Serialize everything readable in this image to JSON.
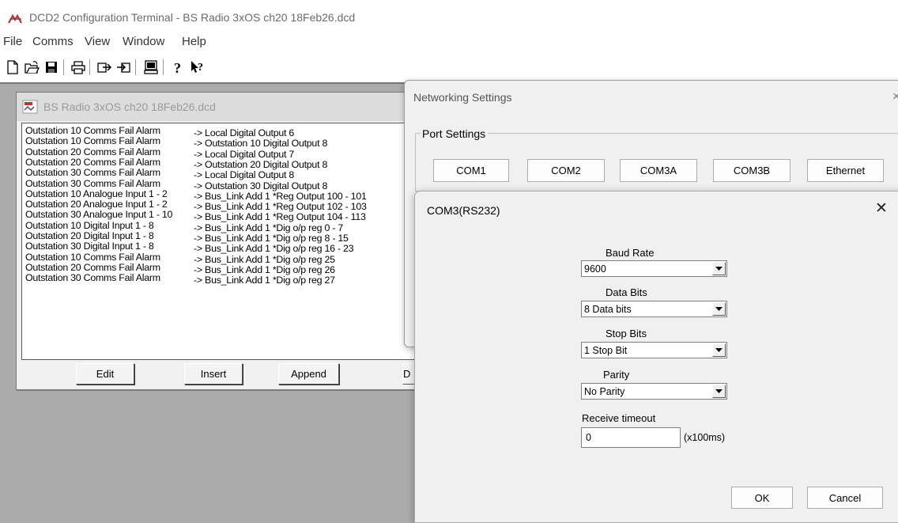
{
  "app": {
    "title": "DCD2 Configuration Terminal - BS Radio 3xOS ch20 18Feb26.dcd",
    "icon": "dcd-app-icon"
  },
  "menu": [
    "File",
    "Comms",
    "View",
    "Window",
    "Help"
  ],
  "toolbar": {
    "buttons": [
      "new-document-icon",
      "open-folder-icon",
      "save-disk-icon",
      "print-icon",
      "upload-icon",
      "download-icon",
      "terminal-icon",
      "help-icon",
      "context-help-icon"
    ]
  },
  "document_window": {
    "title": "BS Radio 3xOS ch20 18Feb26.dcd",
    "rows": [
      {
        "source": "Outstation 10 Comms Fail Alarm",
        "target": "-> Local Digital Output 6"
      },
      {
        "source": "Outstation 10 Comms Fail Alarm",
        "target": "-> Outstation 10 Digital Output 8"
      },
      {
        "source": "Outstation 20 Comms Fail Alarm",
        "target": "-> Local Digital Output 7"
      },
      {
        "source": "Outstation 20 Comms Fail Alarm",
        "target": "-> Outstation 20 Digital Output 8"
      },
      {
        "source": "Outstation 30 Comms Fail Alarm",
        "target": "-> Local Digital Output 8"
      },
      {
        "source": "Outstation 30 Comms Fail Alarm",
        "target": "-> Outstation 30 Digital Output 8"
      },
      {
        "source": "Outstation 10 Analogue Input 1 - 2",
        "target": "-> Bus_Link Add 1 *Reg Output 100 - 101"
      },
      {
        "source": "Outstation 20 Analogue Input 1 - 2",
        "target": "-> Bus_Link Add 1 *Reg Output 102 - 103"
      },
      {
        "source": "Outstation 30 Analogue Input 1 - 10",
        "target": "-> Bus_Link Add 1 *Reg Output 104 - 113"
      },
      {
        "source": "Outstation 10 Digital Input 1 - 8",
        "target": "-> Bus_Link Add 1 *Dig o/p reg 0 - 7"
      },
      {
        "source": "Outstation 20 Digital Input 1 - 8",
        "target": "-> Bus_Link Add 1 *Dig o/p reg 8 - 15"
      },
      {
        "source": "Outstation 30 Digital Input 1 - 8",
        "target": "-> Bus_Link Add 1 *Dig o/p reg 16 - 23"
      },
      {
        "source": "Outstation 10 Comms Fail Alarm",
        "target": "-> Bus_Link Add 1 *Dig o/p reg 25"
      },
      {
        "source": "Outstation 20 Comms Fail Alarm",
        "target": "-> Bus_Link Add 1 *Dig o/p reg 26"
      },
      {
        "source": "Outstation 30 Comms Fail Alarm",
        "target": "-> Bus_Link Add 1 *Dig o/p reg 27"
      }
    ],
    "buttons": {
      "edit": "Edit",
      "insert": "Insert",
      "append": "Append",
      "fourth": "D"
    }
  },
  "networking": {
    "title": "Networking Settings",
    "close": "×",
    "group_label": "Port Settings",
    "ports": [
      "COM1",
      "COM2",
      "COM3A",
      "COM3B",
      "Ethernet"
    ]
  },
  "com3": {
    "title": "COM3(RS232)",
    "close": "✕",
    "baud_label": "Baud Rate",
    "baud_value": "9600",
    "data_bits_label": "Data Bits",
    "data_bits_value": "8 Data bits",
    "stop_bits_label": "Stop Bits",
    "stop_bits_value": "1 Stop Bit",
    "parity_label": "Parity",
    "parity_value": "No Parity",
    "timeout_label": "Receive timeout",
    "timeout_value": "0",
    "timeout_unit": "(x100ms)",
    "ok": "OK",
    "cancel": "Cancel"
  },
  "colors": {
    "workspace": "#ababab",
    "dialog": "#f0f0f0"
  }
}
